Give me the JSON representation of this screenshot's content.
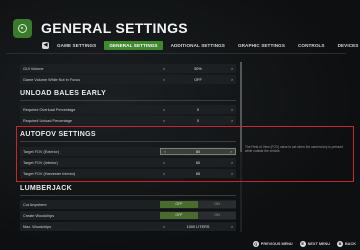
{
  "header": {
    "title": "GENERAL SETTINGS"
  },
  "tabs": [
    {
      "label": "GAME SETTINGS"
    },
    {
      "label": "GENERAL SETTINGS"
    },
    {
      "label": "ADDITIONAL SETTINGS"
    },
    {
      "label": "GRAPHIC SETTINGS"
    },
    {
      "label": "CONTROLS"
    },
    {
      "label": "DEVICES"
    }
  ],
  "rows_top": [
    {
      "label": "GUI Volume",
      "value": "50%"
    },
    {
      "label": "Game Volume While Not In Focus",
      "value": "OFF"
    }
  ],
  "sections": {
    "unload": {
      "title": "UNLOAD BALES EARLY",
      "rows": [
        {
          "label": "Required Overload Percentage",
          "value": "0"
        },
        {
          "label": "Required Unload Percentage",
          "value": "0"
        }
      ]
    },
    "autofov": {
      "title": "AUTOFOV SETTINGS",
      "rows": [
        {
          "label": "Target FOV (Exterior)",
          "value": "80"
        },
        {
          "label": "Target FOV (Interior)",
          "value": "60"
        },
        {
          "label": "Target FOV (Harvester Interior)",
          "value": "65"
        }
      ],
      "tooltip": "The Field of View (FOV) value to set when the camera key is pressed while outside the vehicle."
    },
    "lumberjack": {
      "title": "LUMBERJACK",
      "rows": [
        {
          "label": "Cut Anywhere",
          "on": "OFF",
          "off": "ON"
        },
        {
          "label": "Create Woodchips",
          "on": "OFF",
          "off": "ON"
        },
        {
          "label": "Max. Woodchips",
          "value": "1000 LITERS"
        }
      ]
    }
  },
  "footer": {
    "prev_label": "PREVIOUS MENU",
    "next_label": "NEXT MENU",
    "back_label": "BACK",
    "prev_glyph": "Q",
    "next_glyph": "E",
    "back_glyph": "B"
  }
}
